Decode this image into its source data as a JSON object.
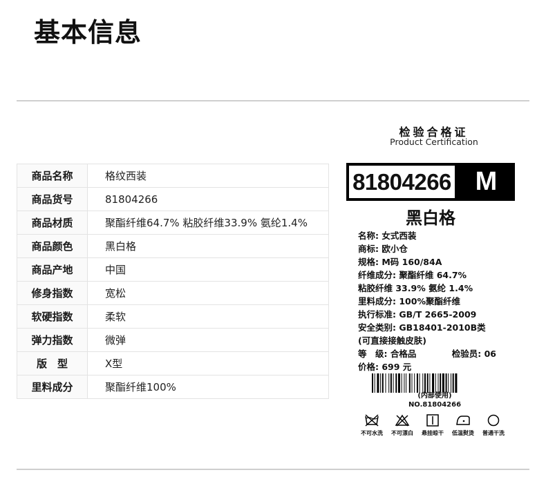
{
  "page": {
    "title": "基本信息"
  },
  "info_table": {
    "rows": [
      {
        "label": "商品名称",
        "value": "格纹西装"
      },
      {
        "label": "商品货号",
        "value": "81804266"
      },
      {
        "label": "商品材质",
        "value": "聚酯纤维64.7% 粘胶纤维33.9% 氨纶1.4%"
      },
      {
        "label": "商品颜色",
        "value": "黑白格"
      },
      {
        "label": "商品产地",
        "value": "中国"
      },
      {
        "label": "修身指数",
        "value": "宽松"
      },
      {
        "label": "软硬指数",
        "value": "柔软"
      },
      {
        "label": "弹力指数",
        "value": "微弹"
      },
      {
        "label": "版　型",
        "value": "X型"
      },
      {
        "label": "里料成分",
        "value": "聚酯纤维100%"
      }
    ]
  },
  "certificate": {
    "title": "检验合格证",
    "subtitle": "Product Certification",
    "code": "81804266",
    "size": "M",
    "color_name": "黑白格",
    "lines": [
      "名称: 女式西装",
      "商标: 欧小仓",
      "规格: M码 160/84A",
      "纤维成分: 聚酯纤维 64.7%",
      "粘胶纤维 33.9% 氨纶 1.4%",
      "里料成分: 100%聚酯纤维",
      "执行标准: GB/T 2665-2009",
      "安全类别: GB18401-2010B类",
      "(可直接接触皮肤)"
    ],
    "grade": "等　级: 合格品",
    "inspector": "检验员: 06",
    "price": "价格: 699 元",
    "barcode_note": "(内部使用)",
    "barcode_number": "NO.81804266",
    "care": [
      {
        "icon": "no-water-wash-icon",
        "label": "不可水洗"
      },
      {
        "icon": "no-bleach-icon",
        "label": "不可漂白"
      },
      {
        "icon": "hang-dry-icon",
        "label": "悬挂晾干"
      },
      {
        "icon": "low-temp-iron-icon",
        "label": "低温熨烫"
      },
      {
        "icon": "dry-clean-icon",
        "label": "普通干洗"
      }
    ]
  }
}
